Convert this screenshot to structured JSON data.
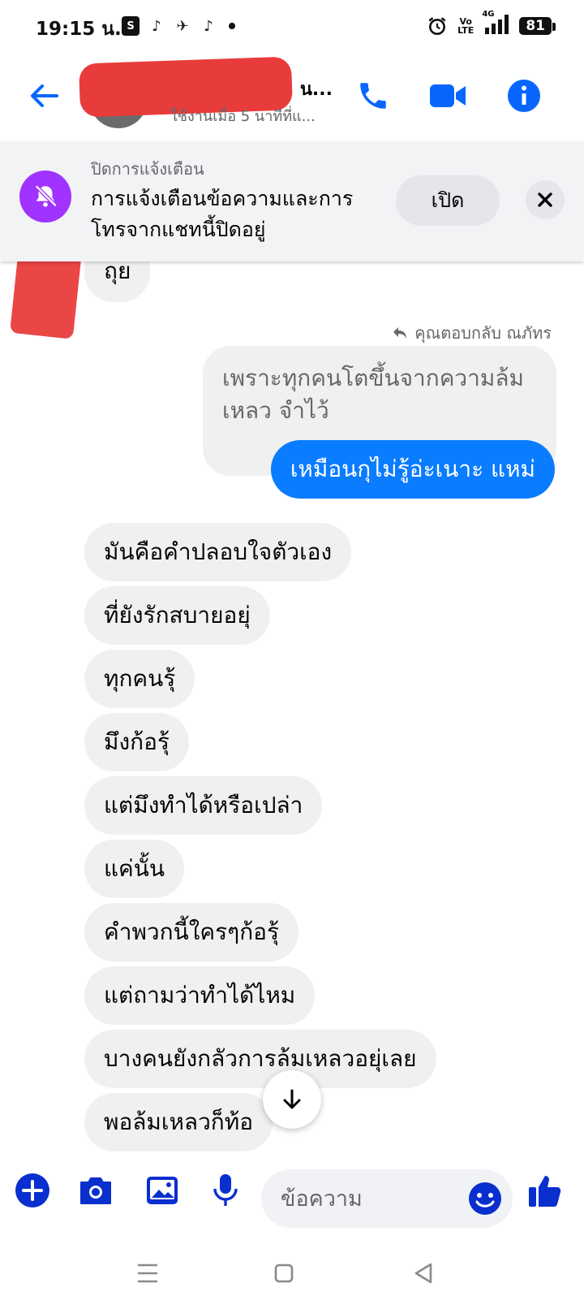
{
  "status": {
    "time": "19:15 น.",
    "volte_top": "Vo",
    "volte_bottom": "LTE",
    "network": "4G",
    "battery": "81"
  },
  "header": {
    "contact_name": "น...",
    "contact_status": "ใช้งานเมื่อ 5 นาทีที่แ..."
  },
  "banner": {
    "title": "ปิดการแจ้งเตือน",
    "text": "การแจ้งเตือนข้อความและการโทรจากแชทนี้ปิดอยู่",
    "open_label": "เปิด"
  },
  "messages": {
    "first_partial": "ถุย",
    "reply_note": "คุณตอบกลับ ณภัทร",
    "replied_text": "เพราะทุกคนโตขึ้นจากความล้มเหลว จำไว้",
    "outgoing": "เหมือนกุไม่รู้อ่ะเนาะ แหม่",
    "incoming": [
      "มันคือคำปลอบใจตัวเอง",
      "ที่ยังรักสบายอยุ่",
      "ทุกคนรุ้",
      "มึงก้อรุ้",
      "แต่มึงทำได้หรือเปล่า",
      "แค่นั้น",
      "คำพวกนี้ใครๆก้อรุ้",
      "แต่ถามว่าทำได้ไหม",
      "บางคนยังกลัวการล้มเหลวอยุ่เลย",
      "พอล้มเหลวก็ท้อ"
    ]
  },
  "composer": {
    "placeholder": "ข้อความ"
  },
  "colors": {
    "accent": "#0a7cff",
    "icon_blue": "#0866ff",
    "mute_purple": "#a033ff",
    "bubble_gray": "#f0f0f0",
    "redaction": "#e83c3c"
  },
  "icons": [
    "back-arrow-icon",
    "phone-icon",
    "video-icon",
    "info-icon",
    "bell-off-icon",
    "close-icon",
    "reply-arrow-icon",
    "arrow-down-icon",
    "plus-icon",
    "camera-icon",
    "image-icon",
    "mic-icon",
    "emoji-icon",
    "thumbs-up-icon",
    "menu-icon",
    "home-square-icon",
    "back-triangle-icon"
  ]
}
